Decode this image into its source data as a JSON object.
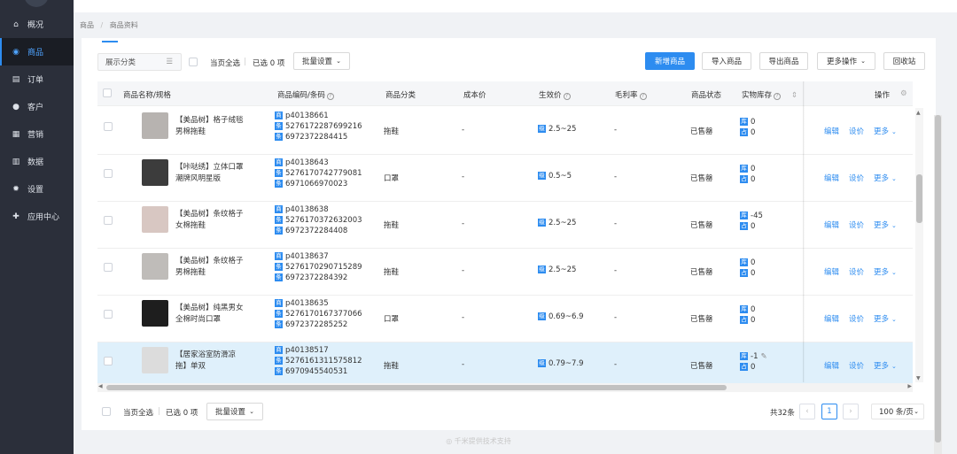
{
  "sidebar": {
    "items": [
      {
        "icon": "home-icon",
        "glyph": "⌂",
        "label": "概况"
      },
      {
        "icon": "goods-icon",
        "glyph": "◉",
        "label": "商品"
      },
      {
        "icon": "order-icon",
        "glyph": "▤",
        "label": "订单"
      },
      {
        "icon": "customer-icon",
        "glyph": "●",
        "label": "客户"
      },
      {
        "icon": "marketing-icon",
        "glyph": "▦",
        "label": "营销"
      },
      {
        "icon": "data-icon",
        "glyph": "▥",
        "label": "数据"
      },
      {
        "icon": "settings-icon",
        "glyph": "✹",
        "label": "设置"
      },
      {
        "icon": "app-center-icon",
        "glyph": "✚",
        "label": "应用中心"
      }
    ],
    "active_index": 1
  },
  "breadcrumb": [
    "商品",
    "/",
    "商品资料"
  ],
  "toolbar": {
    "category_placeholder": "展示分类",
    "select_page": "当页全选",
    "selected": "已选 0 项",
    "batch": "批量设置",
    "new_product": "新增商品",
    "import": "导入商品",
    "export": "导出商品",
    "more_ops": "更多操作",
    "recycle": "回收站"
  },
  "columns": [
    "商品名称/规格",
    "商品编码/条码",
    "商品分类",
    "成本价",
    "生效价",
    "毛利率",
    "商品状态",
    "实物库存",
    "操作"
  ],
  "rows": [
    {
      "name1": "【美品树】格子绒毯",
      "name2": "男棉拖鞋",
      "code": "p40138661",
      "barcode1": "5276172287699216",
      "barcode2": "6972372284415",
      "category": "拖鞋",
      "cost": "-",
      "price": "2.5~25",
      "margin": "-",
      "status": "已售罄",
      "stock1": "0",
      "stock2": "0"
    },
    {
      "name1": "【咔哒绣】立体口罩",
      "name2": "潮牌风明星版",
      "code": "p40138643",
      "barcode1": "5276170742779081",
      "barcode2": "6971066970023",
      "category": "口罩",
      "cost": "-",
      "price": "0.5~5",
      "margin": "-",
      "status": "已售罄",
      "stock1": "0",
      "stock2": "0"
    },
    {
      "name1": "【美品树】条纹格子",
      "name2": "女棉拖鞋",
      "code": "p40138638",
      "barcode1": "5276170372632003",
      "barcode2": "6972372284408",
      "category": "拖鞋",
      "cost": "-",
      "price": "2.5~25",
      "margin": "-",
      "status": "已售罄",
      "stock1": "-45",
      "stock2": "0"
    },
    {
      "name1": "【美品树】条纹格子",
      "name2": "男棉拖鞋",
      "code": "p40138637",
      "barcode1": "5276170290715289",
      "barcode2": "6972372284392",
      "category": "拖鞋",
      "cost": "-",
      "price": "2.5~25",
      "margin": "-",
      "status": "已售罄",
      "stock1": "0",
      "stock2": "0"
    },
    {
      "name1": "【美品树】纯黑男女",
      "name2": "全棉时尚口罩",
      "code": "p40138635",
      "barcode1": "5276170167377066",
      "barcode2": "6972372285252",
      "category": "口罩",
      "cost": "-",
      "price": "0.69~6.9",
      "margin": "-",
      "status": "已售罄",
      "stock1": "0",
      "stock2": "0"
    },
    {
      "name1": "【居家浴室防滑凉",
      "name2": "拖】单双",
      "code": "p40138517",
      "barcode1": "5276161311575812",
      "barcode2": "6970945540531",
      "category": "拖鞋",
      "cost": "-",
      "price": "0.79~7.9",
      "margin": "-",
      "status": "已售罄",
      "stock1": "-1",
      "stock2": "0"
    }
  ],
  "actions": {
    "edit": "编辑",
    "setprice": "设价",
    "more": "更多"
  },
  "tags": {
    "code": "商",
    "barcode": "条",
    "barcode_alt": "条",
    "stock": "库",
    "stock2": "占",
    "price": "级"
  },
  "pagination": {
    "total": "共32条",
    "current": "1",
    "page_size": "100 条/页"
  },
  "footer": "千米提供技术支持",
  "colors": {
    "accent": "#2d8cf0",
    "sidebar": "#2b2f3a"
  }
}
